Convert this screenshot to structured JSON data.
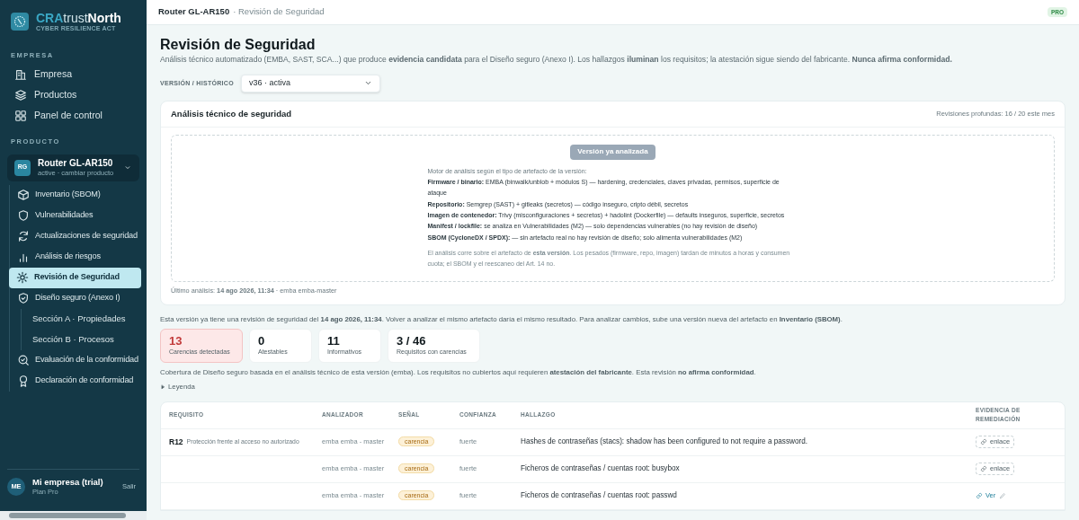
{
  "sidebar": {
    "logo": {
      "brand_a": "CRA",
      "brand_b": "trust",
      "brand_c": "North",
      "tagline": "CYBER RESILIENCE ACT"
    },
    "company_heading": "EMPRESA",
    "company_items": [
      {
        "label": "Empresa",
        "selected": false
      },
      {
        "label": "Productos",
        "selected": false
      },
      {
        "label": "Panel de control",
        "selected": false
      }
    ],
    "product_heading": "PRODUCTO",
    "product_switcher": {
      "initials": "RG",
      "name": "Router GL-AR150",
      "subtitle": "active · cambiar producto"
    },
    "product_items": [
      {
        "label": "Inventario (SBOM)",
        "selected": false
      },
      {
        "label": "Vulnerabilidades",
        "selected": false
      },
      {
        "label": "Actualizaciones de seguridad",
        "selected": false
      },
      {
        "label": "Análisis de riesgos",
        "selected": false
      },
      {
        "label": "Revisión de Seguridad",
        "selected": true
      },
      {
        "label": "Diseño seguro (Anexo I)",
        "selected": false,
        "children": [
          {
            "label": "Sección A · Propiedades",
            "selected": false
          },
          {
            "label": "Sección B · Procesos",
            "selected": false
          }
        ]
      },
      {
        "label": "Evaluación de la conformidad",
        "selected": false
      },
      {
        "label": "Declaración de conformidad",
        "selected": false
      }
    ],
    "account": {
      "initials": "ME",
      "name": "Mi empresa (trial)",
      "plan": "Plan Pro",
      "logout": "Salir"
    }
  },
  "header": {
    "breadcrumb_product": "Router GL-AR150",
    "breadcrumb_page": "· Revisión de Seguridad",
    "plan_badge": "PRO"
  },
  "page": {
    "title": "Revisión de Seguridad",
    "description": "Análisis técnico automatizado (EMBA, SAST, SCA...) que produce **evidencia candidata** para el Diseño seguro (Anexo I). Los hallazgos **iluminan** los requisitos; la atestación sigue siendo del fabricante. **Nunca afirma conformidad.**",
    "version_label": "VERSIÓN / HISTÓRICO",
    "version_value": "v36 · activa"
  },
  "analysis_card": {
    "title": "Análisis técnico de seguridad",
    "quota": "Revisiones profundas: 16 / 20 este mes",
    "button": {
      "label": "Versión ya analizada",
      "disabled": true
    },
    "engines_intro": "Motor de análisis según el tipo de artefacto de la versión:",
    "engines": [
      "**Firmware / binario:** EMBA (binwalk/unblob + módulos S) — hardening, credenciales, claves privadas, permisos, superficie de ataque",
      "**Repositorio:** Semgrep (SAST) + gitleaks (secretos) — código inseguro, cripto débil, secretos",
      "**Imagen de contenedor:** Trivy (misconfiguraciones + secretos) + hadolint (Dockerfile) — defaults inseguros, superficie, secretos",
      "**Manifest / lockfile:** se analiza en Vulnerabilidades (M2) — solo dependencias vulnerables (no hay revisión de diseño)",
      "**SBOM (CycloneDX / SPDX):** — sin artefacto real no hay revisión de diseño; solo alimenta vulnerabilidades (M2)"
    ],
    "note": "El análisis corre sobre el artefacto de **esta versión**. Los pesados (firmware, repo, imagen) tardan de minutos a horas y consumen cuota; el SBOM y el reescaneo del Art. 14 no.",
    "last_analysis": "Último análisis: **14 ago 2026, 11:34** · emba emba-master"
  },
  "already_notice": "Esta versión ya tiene una revisión de seguridad del **14 ago 2026, 11:34**. Volver a analizar el mismo artefacto daría el mismo resultado. Para analizar cambios, sube una versión nueva del artefacto en **Inventario (SBOM)**.",
  "stats": [
    {
      "value": "13",
      "label": "Carencias detectadas",
      "highlighted": true
    },
    {
      "value": "0",
      "label": "Atestables",
      "highlighted": false
    },
    {
      "value": "11",
      "label": "Informativos",
      "highlighted": false
    },
    {
      "value": "3 / 46",
      "label": "Requisitos con carencias",
      "highlighted": false
    }
  ],
  "coverage_note": "Cobertura de Diseño seguro basada en el análisis técnico de esta versión (emba). Los requisitos no cubiertos aquí requieren **atestación del fabricante**. Esta revisión **no afirma conformidad**.",
  "legend": {
    "label": "Leyenda",
    "expanded": false
  },
  "table": {
    "columns": [
      "REQUISITO",
      "ANALIZADOR",
      "SEÑAL",
      "CONFIANZA",
      "HALLAZGO",
      "EVIDENCIA DE REMEDIACIÓN"
    ],
    "rows": [
      {
        "req_code": "R12",
        "req_name": "Protección frente al acceso no autorizado",
        "analyzer": "emba emba - master",
        "signal": "carencia",
        "confidence": "fuerte",
        "finding": "Hashes de contraseñas (stacs): shadow has been configured to not require a password.",
        "evidence": {
          "kind": "add",
          "label": "enlace"
        }
      },
      {
        "analyzer": "emba emba - master",
        "signal": "carencia",
        "confidence": "fuerte",
        "finding": "Ficheros de contraseñas / cuentas root: busybox",
        "evidence": {
          "kind": "add",
          "label": "enlace"
        }
      },
      {
        "analyzer": "emba emba - master",
        "signal": "carencia",
        "confidence": "fuerte",
        "finding": "Ficheros de contraseñas / cuentas root: passwd",
        "evidence": {
          "kind": "view",
          "label": "Ver"
        }
      }
    ]
  }
}
